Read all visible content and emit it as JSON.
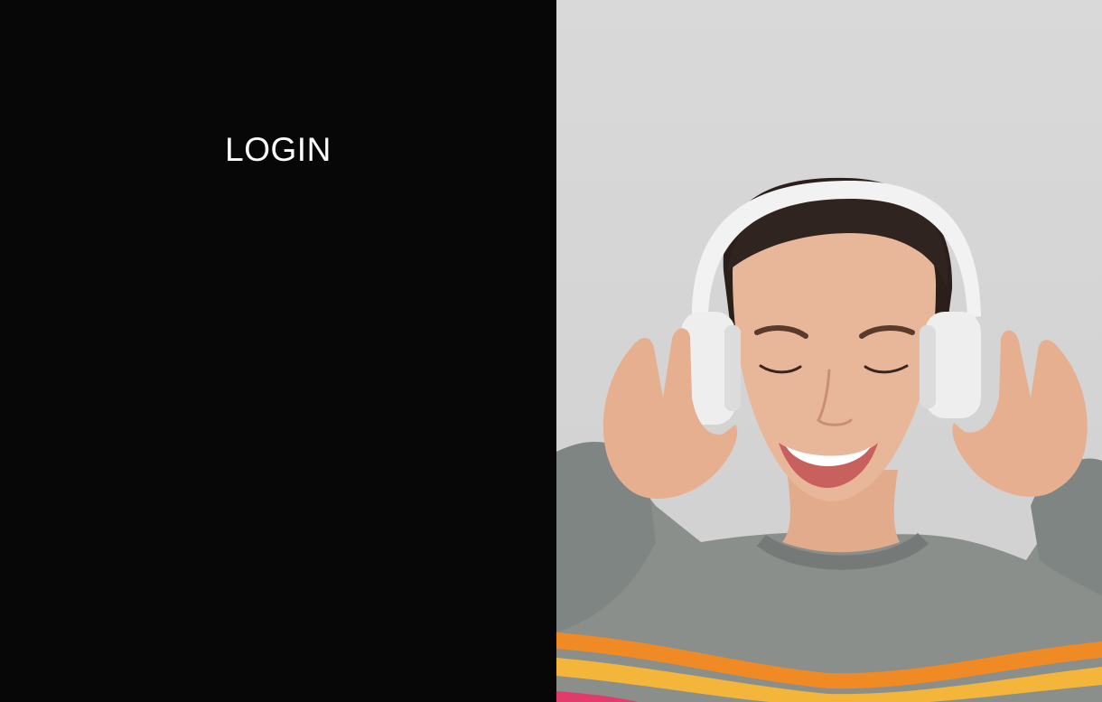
{
  "login": {
    "heading": "LOGIN"
  },
  "hero": {
    "image": "woman-wearing-headphones-photo",
    "colors": {
      "background": "#d6d6d6",
      "skin": "#e8b79a",
      "hair": "#2a1f1a",
      "headphones": "#f2f2f2",
      "sweater": "#8a8f8c",
      "stripe_yellow": "#f4b63a",
      "stripe_orange": "#f08a24",
      "stripe_pink": "#e23b6b"
    }
  },
  "colors": {
    "panel_background": "#070708",
    "heading_text": "#ffffff"
  }
}
